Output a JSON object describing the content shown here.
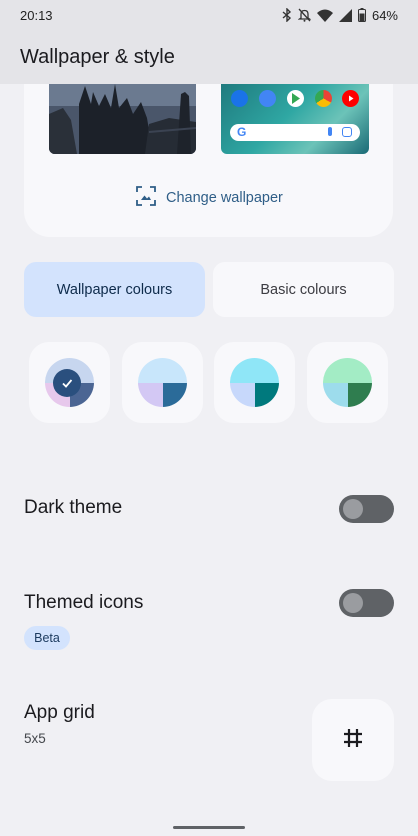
{
  "status_bar": {
    "time": "20:13",
    "battery": "64%",
    "icons": [
      "bluetooth-icon",
      "notifications-off-icon",
      "wifi-icon",
      "signal-icon",
      "battery-icon"
    ]
  },
  "app_bar": {
    "title": "Wallpaper & style"
  },
  "preview": {
    "lock_screen": "lock-screen-preview",
    "home_screen": "home-screen-preview",
    "home_apps": [
      "phone-icon",
      "messages-icon",
      "play-store-icon",
      "chrome-icon",
      "youtube-icon"
    ],
    "search_bar": {
      "logo": "G"
    },
    "change_wallpaper_label": "Change wallpaper"
  },
  "colour_tabs": {
    "wallpaper_colours_label": "Wallpaper colours",
    "basic_colours_label": "Basic colours",
    "selected": "wallpaper_colours"
  },
  "swatches": [
    {
      "selected": true,
      "top": "#c7d6ef",
      "bottom_left": "#e7c8ec",
      "bottom_right": "#4b6593"
    },
    {
      "selected": false,
      "top": "#c8e6fb",
      "bottom_left": "#d3c8f4",
      "bottom_right": "#2b6b99"
    },
    {
      "selected": false,
      "top": "#8fe6f7",
      "bottom_left": "#c7d8fb",
      "bottom_right": "#00797d"
    },
    {
      "selected": false,
      "top": "#a3ecc5",
      "bottom_left": "#9ddcec",
      "bottom_right": "#2f7d4f"
    }
  ],
  "dark_theme": {
    "label": "Dark theme",
    "on": false
  },
  "themed_icons": {
    "label": "Themed icons",
    "badge": "Beta",
    "on": false
  },
  "app_grid": {
    "label": "App grid",
    "value": "5x5"
  },
  "colors": {
    "accent": "#2f5e87",
    "selected_tab": "#d3e3fd",
    "toggle_off": "#5f6266"
  }
}
